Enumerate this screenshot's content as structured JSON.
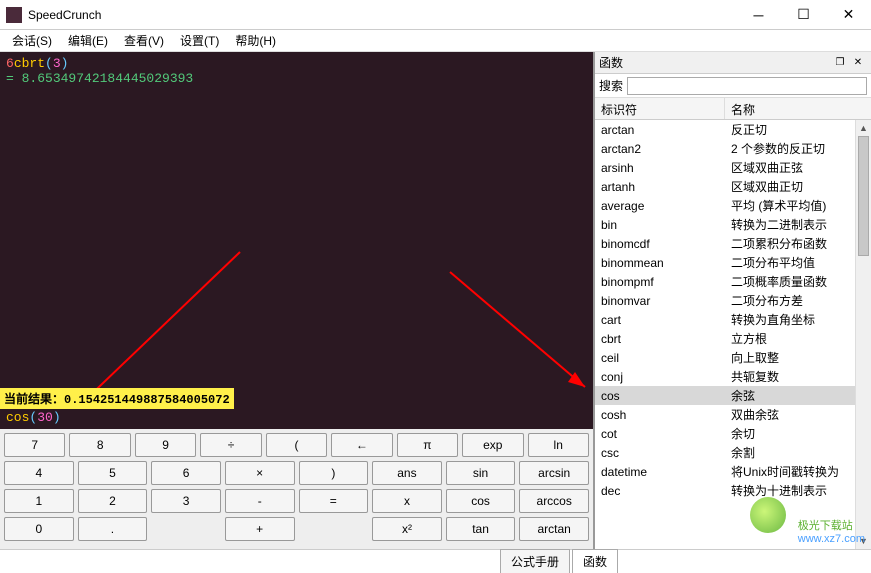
{
  "window": {
    "title": "SpeedCrunch"
  },
  "menu": {
    "items": [
      "会话(S)",
      "编辑(E)",
      "查看(V)",
      "设置(T)",
      "帮助(H)"
    ]
  },
  "console": {
    "expr_prefix": "6",
    "expr_func": "cbrt",
    "expr_arg": "3",
    "result_prefix": "= ",
    "result_value": "8.65349742184445029393"
  },
  "result_bar": {
    "label": "当前结果：",
    "value": "0.154251449887584005072"
  },
  "input": {
    "func": "cos",
    "arg": "30"
  },
  "keypad": {
    "rows": [
      [
        "7",
        "8",
        "9",
        "÷",
        "(",
        "←",
        "π",
        "exp",
        "ln"
      ],
      [
        "4",
        "5",
        "6",
        "×",
        ")",
        "ans",
        "sin",
        "arcsin"
      ],
      [
        "1",
        "2",
        "3",
        "-",
        "=",
        "x",
        "cos",
        "arccos"
      ],
      [
        "0",
        ".",
        "",
        "+",
        "",
        "x²",
        "tan",
        "arctan"
      ]
    ]
  },
  "panel": {
    "title": "函数",
    "search_label": "搜索",
    "search_value": "",
    "col1": "标识符",
    "col2": "名称",
    "selected": "cos",
    "functions": [
      {
        "id": "arctan",
        "name": "反正切"
      },
      {
        "id": "arctan2",
        "name": "2 个参数的反正切"
      },
      {
        "id": "arsinh",
        "name": "区域双曲正弦"
      },
      {
        "id": "artanh",
        "name": "区域双曲正切"
      },
      {
        "id": "average",
        "name": "平均 (算术平均值)"
      },
      {
        "id": "bin",
        "name": "转换为二进制表示"
      },
      {
        "id": "binomcdf",
        "name": "二项累积分布函数"
      },
      {
        "id": "binommean",
        "name": "二项分布平均值"
      },
      {
        "id": "binompmf",
        "name": "二项概率质量函数"
      },
      {
        "id": "binomvar",
        "name": "二项分布方差"
      },
      {
        "id": "cart",
        "name": "转换为直角坐标"
      },
      {
        "id": "cbrt",
        "name": "立方根"
      },
      {
        "id": "ceil",
        "name": "向上取整"
      },
      {
        "id": "conj",
        "name": "共轭复数"
      },
      {
        "id": "cos",
        "name": "余弦"
      },
      {
        "id": "cosh",
        "name": "双曲余弦"
      },
      {
        "id": "cot",
        "name": "余切"
      },
      {
        "id": "csc",
        "name": "余割"
      },
      {
        "id": "datetime",
        "name": "将Unix时间戳转换为"
      },
      {
        "id": "dec",
        "name": "转换为十进制表示"
      }
    ]
  },
  "tabs": {
    "items": [
      "公式手册",
      "函数"
    ],
    "active": "函数"
  },
  "watermark": {
    "text1": "极光下载站",
    "text2": "www.xz7.com"
  }
}
